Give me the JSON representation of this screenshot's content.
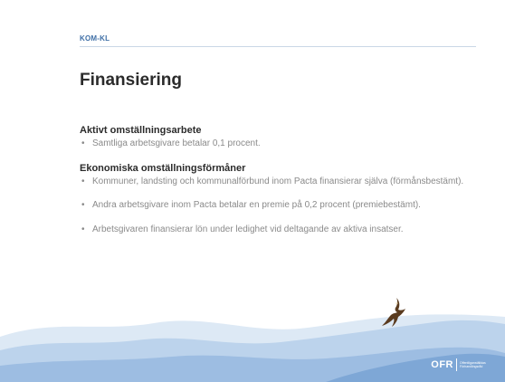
{
  "header": {
    "tag": "KOM-KL"
  },
  "slide": {
    "title": "Finansiering",
    "section1": {
      "heading": "Aktivt omställningsarbete",
      "items": [
        "Samtliga arbetsgivare betalar 0,1 procent."
      ]
    },
    "section2": {
      "heading": "Ekonomiska omställningsförmåner",
      "items": [
        "Kommuner, landsting och kommunalförbund inom Pacta finansierar själva (förmånsbestämt).",
        "Andra arbetsgivare inom Pacta betalar en premie på 0,2 procent (premiebestämt).",
        "Arbetsgivaren finansierar lön under ledighet vid deltagande av aktiva insatser."
      ]
    },
    "bullet_glyph": "•"
  },
  "logo": {
    "mark": "OFR",
    "text": "Offentliganställdas Förhandlingsråd"
  },
  "colors": {
    "accent": "#3f6fa6",
    "mountain_light": "#cfe0f1",
    "mountain_mid": "#a9c6e6",
    "mountain_dark": "#7ea7d6"
  },
  "icons": [
    "eagle-icon",
    "mountains-graphic"
  ]
}
